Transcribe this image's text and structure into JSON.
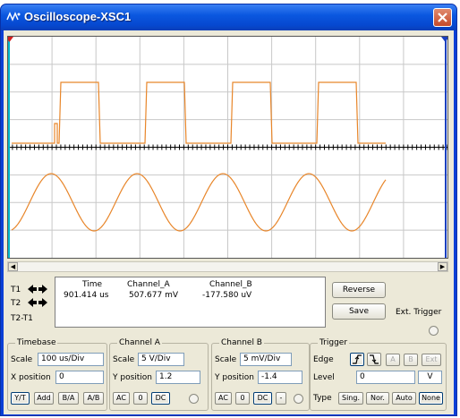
{
  "window": {
    "title": "Oscilloscope-XSC1"
  },
  "measurements": {
    "rows": [
      "T1",
      "T2",
      "T2-T1"
    ],
    "headers": {
      "time": "Time",
      "channel_a": "Channel_A",
      "channel_b": "Channel_B"
    },
    "values": {
      "time": "901.414 us",
      "channel_a": "507.677 mV",
      "channel_b": "-177.580 uV"
    }
  },
  "actions": {
    "reverse": "Reverse",
    "save": "Save",
    "ext_trigger": "Ext. Trigger"
  },
  "timebase": {
    "title": "Timebase",
    "scale_label": "Scale",
    "scale_value": "100 us/Div",
    "xpos_label": "X position",
    "xpos_value": "0",
    "modes": [
      "Y/T",
      "Add",
      "B/A",
      "A/B"
    ],
    "active_mode": "Y/T"
  },
  "channel_a": {
    "title": "Channel A",
    "scale_label": "Scale",
    "scale_value": "5  V/Div",
    "ypos_label": "Y position",
    "ypos_value": "1.2",
    "coupling": [
      "AC",
      "0",
      "DC"
    ],
    "active_coupling": "DC"
  },
  "channel_b": {
    "title": "Channel B",
    "scale_label": "Scale",
    "scale_value": "5  mV/Div",
    "ypos_label": "Y position",
    "ypos_value": "-1.4",
    "coupling": [
      "AC",
      "0",
      "DC",
      "-"
    ],
    "active_coupling": "DC"
  },
  "trigger": {
    "title": "Trigger",
    "edge_label": "Edge",
    "edge_buttons": [
      "A",
      "B",
      "Ext"
    ],
    "level_label": "Level",
    "level_value": "0",
    "level_unit": "V",
    "type_label": "Type",
    "types": [
      "Sing.",
      "Nor.",
      "Auto",
      "None"
    ],
    "active_type": "None"
  },
  "colors": {
    "trace": "#e8862a",
    "cursor1": "#00b4c8",
    "cursor2": "#1a40c0",
    "title_bar": "#0b58e0"
  }
}
